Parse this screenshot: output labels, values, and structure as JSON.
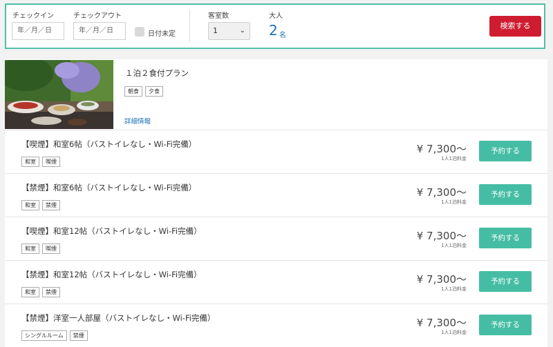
{
  "search": {
    "checkin_label": "チェックイン",
    "checkin_placeholder": "年／月／日",
    "checkout_label": "チェックアウト",
    "checkout_placeholder": "年／月／日",
    "undecided_label": "日付未定",
    "rooms_label": "客室数",
    "rooms_value": "1",
    "adults_label": "大人",
    "adults_value": "2",
    "adults_unit": "名",
    "search_button": "検索する",
    "accent_color": "#4dbfa8",
    "button_color": "#cf1c30"
  },
  "plan": {
    "title": "１泊２食付プラン",
    "tags": [
      "朝食",
      "夕食"
    ],
    "details_link": "詳細情報"
  },
  "rooms": [
    {
      "name": "【喫煙】和室6帖（バストイレなし・Wi-Fi完備）",
      "tags": [
        "和室",
        "喫煙"
      ],
      "price": "¥ 7,300〜",
      "price_note": "1人1泊料金",
      "button": "予約する"
    },
    {
      "name": "【禁煙】和室6帖（バストイレなし・Wi-Fi完備）",
      "tags": [
        "和室",
        "禁煙"
      ],
      "price": "¥ 7,300〜",
      "price_note": "1人1泊料金",
      "button": "予約する"
    },
    {
      "name": "【喫煙】和室12帖（バストイレなし・Wi-Fi完備）",
      "tags": [
        "和室",
        "喫煙"
      ],
      "price": "¥ 7,300〜",
      "price_note": "1人1泊料金",
      "button": "予約する"
    },
    {
      "name": "【禁煙】和室12帖（バストイレなし・Wi-Fi完備）",
      "tags": [
        "和室",
        "禁煙"
      ],
      "price": "¥ 7,300〜",
      "price_note": "1人1泊料金",
      "button": "予約する"
    },
    {
      "name": "【禁煙】洋室一人部屋（バストイレなし・Wi-Fi完備）",
      "tags": [
        "シングルルーム",
        "禁煙"
      ],
      "price": "¥ 7,300〜",
      "price_note": "1人1泊料金",
      "button": "予約する"
    }
  ],
  "colors": {
    "reserve_button": "#45bda4",
    "link": "#1e6fb5"
  }
}
